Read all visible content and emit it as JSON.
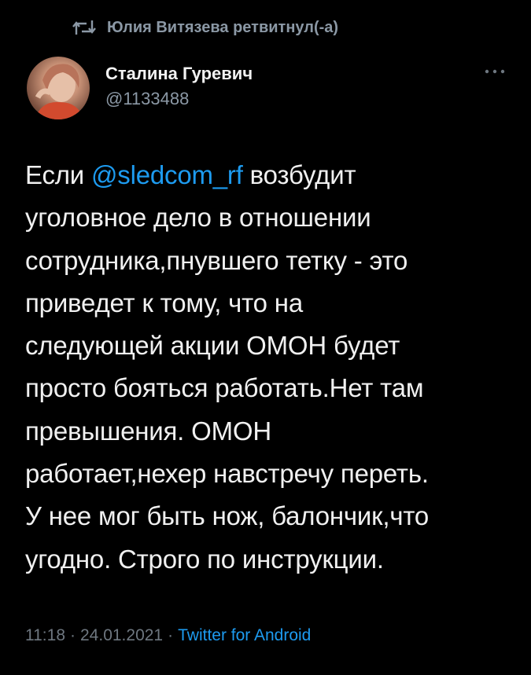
{
  "retweet": {
    "text": "Юлия Витязева ретвитнул(-а)",
    "icon": "retweet-icon"
  },
  "author": {
    "name": "Сталина Гуревич",
    "handle": "@1133488"
  },
  "more": {
    "icon": "more-dots-icon"
  },
  "tweet": {
    "line1_pre": "Если ",
    "mention": "@sledcom_rf",
    "line1_post": " возбудит",
    "lines": [
      "уголовное дело в отношении",
      "сотрудника,пнувшего тетку - это",
      "приведет к тому, что на",
      "следующей акции ОМОН будет",
      "просто бояться работать.Нет там",
      "превышения. ОМОН",
      "работает,нехер навстречу переть.",
      "У нее мог быть нож, балончик,что",
      "угодно. Строго по инструкции."
    ]
  },
  "meta": {
    "time": "11:18",
    "date": "24.01.2021",
    "separator": "·",
    "source": "Twitter for Android"
  },
  "colors": {
    "background": "#000000",
    "text": "#f0f0f0",
    "secondary": "#8b98a5",
    "link": "#1d9bf0"
  }
}
